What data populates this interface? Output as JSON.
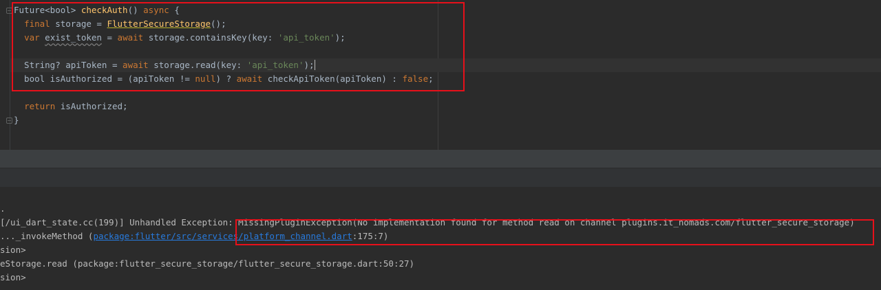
{
  "editor": {
    "lines": [
      {
        "parts": [
          [
            "",
            "Future<bool> "
          ],
          [
            "fn",
            "checkAuth"
          ],
          [
            "",
            "() "
          ],
          [
            "kw",
            "async"
          ],
          [
            "",
            " {"
          ]
        ]
      },
      {
        "parts": [
          [
            "",
            "  "
          ],
          [
            "kw",
            "final"
          ],
          [
            "",
            " storage = "
          ],
          [
            "cls-under",
            "FlutterSecureStorage"
          ],
          [
            "",
            "();"
          ]
        ]
      },
      {
        "parts": [
          [
            "",
            "  "
          ],
          [
            "kw",
            "var"
          ],
          [
            "",
            " "
          ],
          [
            "typo",
            "exist_token"
          ],
          [
            "",
            " = "
          ],
          [
            "kw",
            "await"
          ],
          [
            "",
            " storage.containsKey(key: "
          ],
          [
            "str",
            "'api_token'"
          ],
          [
            "",
            ");"
          ]
        ]
      },
      {
        "parts": [
          [
            "",
            ""
          ]
        ]
      },
      {
        "parts": [
          [
            "",
            "  String? apiToken = "
          ],
          [
            "kw",
            "await"
          ],
          [
            "",
            " storage.read(key: "
          ],
          [
            "str",
            "'api_token'"
          ],
          [
            "",
            ");"
          ]
        ]
      },
      {
        "parts": [
          [
            "",
            "  bool isAuthorized = (apiToken != "
          ],
          [
            "kw",
            "null"
          ],
          [
            "",
            ") ? "
          ],
          [
            "kw",
            "await"
          ],
          [
            "",
            " checkApiToken(apiToken) : "
          ],
          [
            "kw",
            "false"
          ],
          [
            "",
            ";"
          ]
        ]
      },
      {
        "parts": [
          [
            "",
            ""
          ]
        ]
      },
      {
        "parts": [
          [
            "",
            "  "
          ],
          [
            "kw",
            "return"
          ],
          [
            "",
            " isAuthorized;"
          ]
        ]
      },
      {
        "parts": [
          [
            "",
            "}"
          ]
        ]
      }
    ]
  },
  "console": {
    "lines": [
      {
        "parts": [
          [
            "",
            "."
          ]
        ]
      },
      {
        "parts": [
          [
            "",
            "[/ui_dart_state.cc(199)] Unhandled Exception: MissingPluginException(No implementation found for method read on channel plugins.it_nomads.com/flutter_secure_storage)"
          ]
        ]
      },
      {
        "parts": [
          [
            "",
            "..._invokeMethod ("
          ],
          [
            "link",
            "package:flutter/src/services/platform_channel.dart"
          ],
          [
            "",
            ":175:7)"
          ]
        ]
      },
      {
        "parts": [
          [
            "",
            "sion>"
          ]
        ]
      },
      {
        "parts": [
          [
            "",
            "eStorage.read (package:flutter_secure_storage/flutter_secure_storage.dart:50:27)"
          ]
        ]
      },
      {
        "parts": [
          [
            "",
            "sion>"
          ]
        ]
      }
    ]
  },
  "colors": {
    "background": "#2b2b2b",
    "keyword": "#cc7832",
    "function": "#ffc66d",
    "string": "#6a8759",
    "highlight_box": "#e8101a",
    "link": "#287bde"
  }
}
